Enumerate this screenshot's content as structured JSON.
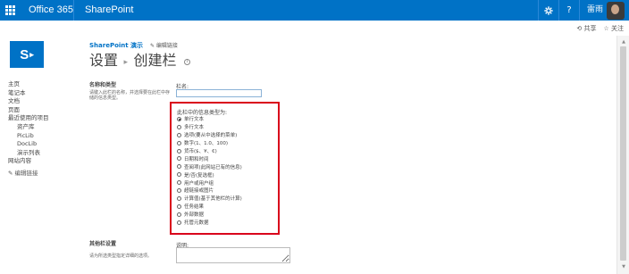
{
  "suite_bar": {
    "brand": "Office 365",
    "product": "SharePoint",
    "username": "雷雨",
    "settings_icon": "gear-icon",
    "help_icon": "?",
    "accent": "#0072c6"
  },
  "actions": {
    "share": "⟲ 共享",
    "follow": "☆ 关注"
  },
  "header": {
    "logo_letter": "S",
    "site_title": "SharePoint 演示",
    "edit_links": "✎ 编辑链接",
    "title_part1": "设置",
    "title_sep": "▸",
    "title_part2": "创建栏",
    "info_icon": "i"
  },
  "leftnav": {
    "items": [
      {
        "label": "主页",
        "sub": false
      },
      {
        "label": "笔记本",
        "sub": false
      },
      {
        "label": "文档",
        "sub": false
      },
      {
        "label": "页面",
        "sub": false
      },
      {
        "label": "最近使用的项目",
        "sub": false
      },
      {
        "label": "资产库",
        "sub": true
      },
      {
        "label": "PicLib",
        "sub": true
      },
      {
        "label": "DocLib",
        "sub": true
      },
      {
        "label": "演示列表",
        "sub": true
      },
      {
        "label": "网站内容",
        "sub": false
      }
    ],
    "edit_links": "✎ 编辑链接"
  },
  "form": {
    "section_title": "名称和类型",
    "section_desc": "请键入此栏的名称，并选择要在此栏中存储的信息类型。",
    "name_label": "栏名:",
    "name_value": "",
    "type_heading": "此栏中的信息类型为:",
    "type_options": [
      {
        "label": "单行文本",
        "selected": true
      },
      {
        "label": "多行文本",
        "selected": false
      },
      {
        "label": "选项(要从中选择的菜单)",
        "selected": false
      },
      {
        "label": "数字(1、1.0、100)",
        "selected": false
      },
      {
        "label": "货币($、¥、€)",
        "selected": false
      },
      {
        "label": "日期和时间",
        "selected": false
      },
      {
        "label": "查阅项(此网站已有的信息)",
        "selected": false
      },
      {
        "label": "是/否(复选框)",
        "selected": false
      },
      {
        "label": "用户或用户组",
        "selected": false
      },
      {
        "label": "超链接或图片",
        "selected": false
      },
      {
        "label": "计算值(基于其他栏的计算)",
        "selected": false
      },
      {
        "label": "任务结果",
        "selected": false
      },
      {
        "label": "外部数据",
        "selected": false
      },
      {
        "label": "托管元数据",
        "selected": false
      }
    ],
    "highlight_color": "#d9001b",
    "section2_title": "其他栏设置",
    "section2_desc": "请为所选类型指定详细的选项。",
    "description_label": "说明:",
    "description_value": ""
  }
}
